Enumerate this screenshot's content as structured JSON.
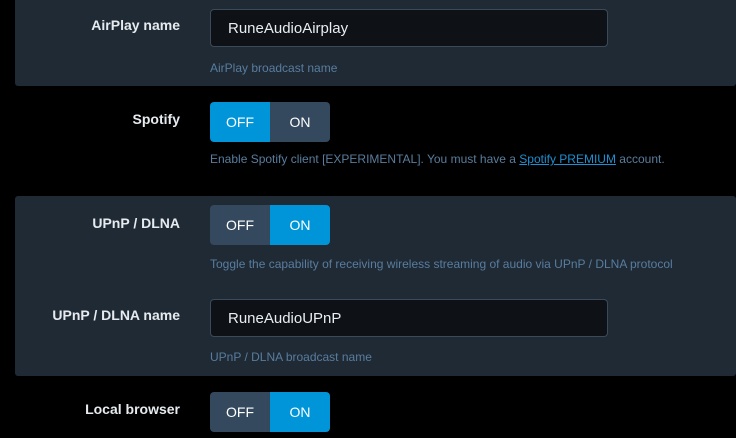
{
  "airplay": {
    "name_label": "AirPlay name",
    "name_value": "RuneAudioAirplay",
    "name_help": "AirPlay broadcast name"
  },
  "spotify": {
    "label": "Spotify",
    "off_label": "OFF",
    "on_label": "ON",
    "state": "OFF",
    "help_prefix": "Enable Spotify client [EXPERIMENTAL]. You must have a ",
    "help_link": "Spotify PREMIUM",
    "help_suffix": " account."
  },
  "upnp": {
    "label": "UPnP / DLNA",
    "off_label": "OFF",
    "on_label": "ON",
    "state": "ON",
    "help": "Toggle the capability of receiving wireless streaming of audio via UPnP / DLNA protocol",
    "name_label": "UPnP / DLNA name",
    "name_value": "RuneAudioUPnP",
    "name_help": "UPnP / DLNA broadcast name"
  },
  "local_browser": {
    "label": "Local browser",
    "off_label": "OFF",
    "on_label": "ON",
    "state": "ON"
  },
  "colors": {
    "active": "#0095d8",
    "inactive": "#34495e",
    "panel": "#202a35",
    "link": "#1f8fd1",
    "help_text": "#587d9e"
  }
}
